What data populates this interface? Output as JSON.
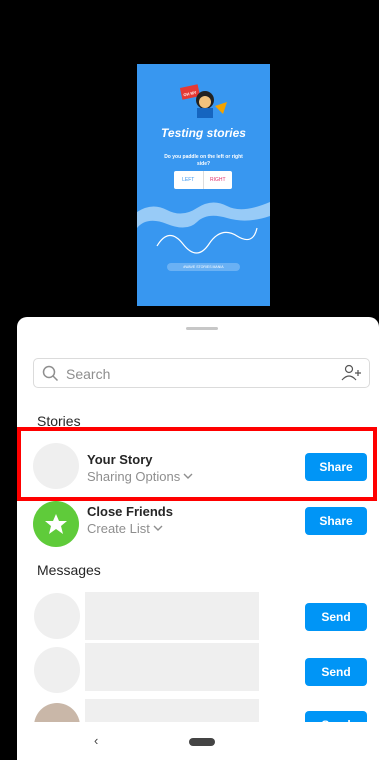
{
  "story_preview": {
    "sticker_text": "OH MY WAVE",
    "title": "Testing stories",
    "question": "Do you paddle on the left or right side?",
    "poll_left": "LEFT",
    "poll_right": "RIGHT",
    "tag": "#WAVE STORIES MANIA",
    "background_color": "#3897f0"
  },
  "search": {
    "placeholder": "Search",
    "icon": "search-icon",
    "add_icon": "add-people-icon"
  },
  "sections": {
    "stories": "Stories",
    "messages": "Messages"
  },
  "stories": [
    {
      "name": "Your Story",
      "sub": "Sharing Options",
      "button": "Share"
    },
    {
      "name": "Close Friends",
      "sub": "Create List",
      "button": "Share"
    }
  ],
  "messages": [
    {
      "button": "Send"
    },
    {
      "button": "Send"
    },
    {
      "button": "Send"
    }
  ],
  "navbar": {
    "back": "‹"
  },
  "colors": {
    "accent": "#0095f6",
    "close_friends": "#5fcb3a",
    "highlight": "#ff0000"
  }
}
